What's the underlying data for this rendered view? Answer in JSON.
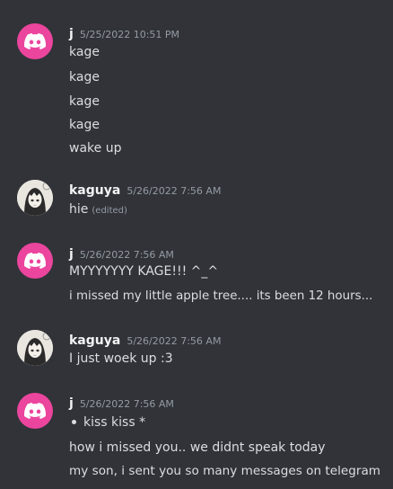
{
  "messages": [
    {
      "author": "j",
      "avatar": "discord-logo-icon",
      "timestamp": "5/25/2022 10:51 PM",
      "lines": [
        "kage",
        "kage",
        "kage",
        "kage",
        "wake up"
      ]
    },
    {
      "author": "kaguya",
      "avatar": "anime-avatar",
      "timestamp": "5/26/2022 7:56 AM",
      "lines": [
        "hie"
      ],
      "edited": "(edited)"
    },
    {
      "author": "j",
      "avatar": "discord-logo-icon",
      "timestamp": "5/26/2022 7:56 AM",
      "lines": [
        "MYYYYYYY KAGE!!! ^_^",
        "i missed my little apple tree.... its been 12 hours..."
      ]
    },
    {
      "author": "kaguya",
      "avatar": "anime-avatar",
      "timestamp": "5/26/2022 7:56 AM",
      "lines": [
        "I just woek up :3"
      ]
    },
    {
      "author": "j",
      "avatar": "discord-logo-icon",
      "timestamp": "5/26/2022 7:56 AM",
      "lines": [
        "kiss kiss *",
        "how i missed you.. we didnt speak today",
        "my son, i sent you so many messages on telegram"
      ]
    }
  ],
  "colors": {
    "background": "#313338",
    "discord_avatar": "#eb459e",
    "username": "#f2f3f5",
    "text": "#dbdee1",
    "muted": "#949ba4"
  }
}
